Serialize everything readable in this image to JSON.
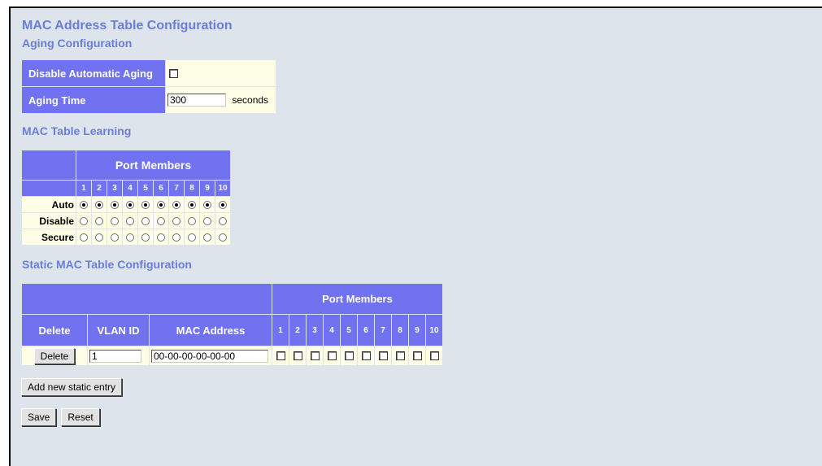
{
  "page_title": "MAC Address Table Configuration",
  "aging": {
    "heading": "Aging Configuration",
    "disable_label": "Disable Automatic Aging",
    "disable_checked": false,
    "time_label": "Aging Time",
    "time_value": "300",
    "time_unit": "seconds"
  },
  "learning": {
    "heading": "MAC Table Learning",
    "port_members_header": "Port Members",
    "ports": [
      "1",
      "2",
      "3",
      "4",
      "5",
      "6",
      "7",
      "8",
      "9",
      "10"
    ],
    "rows": [
      {
        "label": "Auto",
        "selected": true
      },
      {
        "label": "Disable",
        "selected": false
      },
      {
        "label": "Secure",
        "selected": false
      }
    ]
  },
  "static": {
    "heading": "Static MAC Table Configuration",
    "port_members_header": "Port Members",
    "col_delete": "Delete",
    "col_vlan": "VLAN ID",
    "col_mac": "MAC Address",
    "ports": [
      "1",
      "2",
      "3",
      "4",
      "5",
      "6",
      "7",
      "8",
      "9",
      "10"
    ],
    "entry": {
      "delete_label": "Delete",
      "vlan_value": "1",
      "mac_value": "00-00-00-00-00-00"
    }
  },
  "buttons": {
    "add_entry": "Add new static entry",
    "save": "Save",
    "reset": "Reset"
  }
}
